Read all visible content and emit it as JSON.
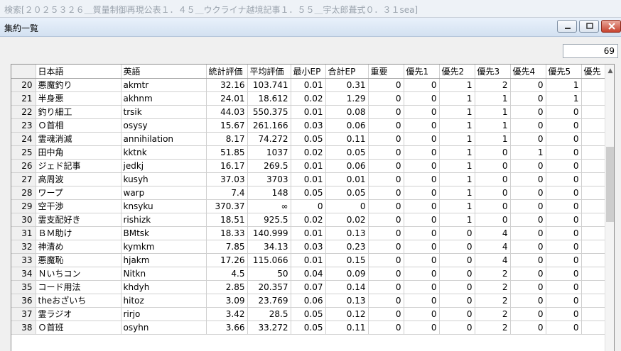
{
  "background_title": "検索[２０２５３２６＿質量制御再現公表１．４５＿ウクライナ越境記事１．５５＿宇太郎葺式０．３１sea]",
  "window": {
    "title": "集約一覧",
    "count": "69"
  },
  "table": {
    "columns": [
      "",
      "日本語",
      "英語",
      "統計評価",
      "平均評価",
      "最小EP",
      "合計EP",
      "重要",
      "優先1",
      "優先2",
      "優先3",
      "優先4",
      "優先5",
      "優先"
    ],
    "rows": [
      [
        "20",
        "悪魔釣り",
        "akmtr",
        "32.16",
        "103.741",
        "0.01",
        "0.31",
        "0",
        "0",
        "1",
        "2",
        "0",
        "1"
      ],
      [
        "21",
        "半身悪",
        "akhnm",
        "24.01",
        "18.612",
        "0.02",
        "1.29",
        "0",
        "0",
        "1",
        "1",
        "0",
        "1"
      ],
      [
        "22",
        "釣り細工",
        "trsik",
        "44.03",
        "550.375",
        "0.01",
        "0.08",
        "0",
        "0",
        "1",
        "1",
        "0",
        "0"
      ],
      [
        "23",
        "Ｏ首相",
        "osysy",
        "15.67",
        "261.166",
        "0.03",
        "0.06",
        "0",
        "0",
        "1",
        "1",
        "0",
        "0"
      ],
      [
        "24",
        "霊魂消滅",
        "annihilation",
        "8.17",
        "74.272",
        "0.05",
        "0.11",
        "0",
        "0",
        "1",
        "1",
        "0",
        "0"
      ],
      [
        "25",
        "田中角",
        "kktnk",
        "51.85",
        "1037",
        "0.02",
        "0.05",
        "0",
        "0",
        "1",
        "0",
        "1",
        "0"
      ],
      [
        "26",
        "ジェド記事",
        "jedkj",
        "16.17",
        "269.5",
        "0.01",
        "0.06",
        "0",
        "0",
        "1",
        "0",
        "0",
        "0"
      ],
      [
        "27",
        "高周波",
        "kusyh",
        "37.03",
        "3703",
        "0.01",
        "0.01",
        "0",
        "0",
        "1",
        "0",
        "0",
        "0"
      ],
      [
        "28",
        "ワープ",
        "warp",
        "7.4",
        "148",
        "0.05",
        "0.05",
        "0",
        "0",
        "1",
        "0",
        "0",
        "0"
      ],
      [
        "29",
        "空干渉",
        "knsyku",
        "370.37",
        "∞",
        "0",
        "0",
        "0",
        "0",
        "1",
        "0",
        "0",
        "0"
      ],
      [
        "30",
        "霊支配好き",
        "rishizk",
        "18.51",
        "925.5",
        "0.02",
        "0.02",
        "0",
        "0",
        "1",
        "0",
        "0",
        "0"
      ],
      [
        "31",
        "ＢＭ助け",
        "BMtsk",
        "18.33",
        "140.999",
        "0.01",
        "0.13",
        "0",
        "0",
        "0",
        "4",
        "0",
        "0"
      ],
      [
        "32",
        "神清め",
        "kymkm",
        "7.85",
        "34.13",
        "0.03",
        "0.23",
        "0",
        "0",
        "0",
        "4",
        "0",
        "0"
      ],
      [
        "33",
        "悪魔恥",
        "hjakm",
        "17.26",
        "115.066",
        "0.01",
        "0.15",
        "0",
        "0",
        "0",
        "4",
        "0",
        "0"
      ],
      [
        "34",
        "Ｎいちコン",
        "Nitkn",
        "4.5",
        "50",
        "0.04",
        "0.09",
        "0",
        "0",
        "0",
        "2",
        "0",
        "0"
      ],
      [
        "35",
        "コード用法",
        "khdyh",
        "2.85",
        "20.357",
        "0.07",
        "0.14",
        "0",
        "0",
        "0",
        "2",
        "0",
        "0"
      ],
      [
        "36",
        "theおざいち",
        "hitoz",
        "3.09",
        "23.769",
        "0.06",
        "0.13",
        "0",
        "0",
        "0",
        "2",
        "0",
        "0"
      ],
      [
        "37",
        "霊ラジオ",
        "rirjo",
        "3.42",
        "28.5",
        "0.05",
        "0.12",
        "0",
        "0",
        "0",
        "2",
        "0",
        "0"
      ],
      [
        "38",
        "Ｏ首班",
        "osyhn",
        "3.66",
        "33.272",
        "0.05",
        "0.11",
        "0",
        "0",
        "0",
        "2",
        "0",
        "0"
      ]
    ]
  }
}
